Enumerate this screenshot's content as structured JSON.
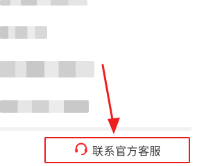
{
  "screen": {
    "blurred_items": [
      "blurred-text-1",
      "blurred-text-2",
      "blurred-text-3",
      "blurred-text-4"
    ]
  },
  "contact": {
    "label": "联系官方客服",
    "icon": "headset-icon",
    "accent_color": "#ea1d1d"
  },
  "annotation": {
    "arrow_color": "#ef1f1f"
  }
}
